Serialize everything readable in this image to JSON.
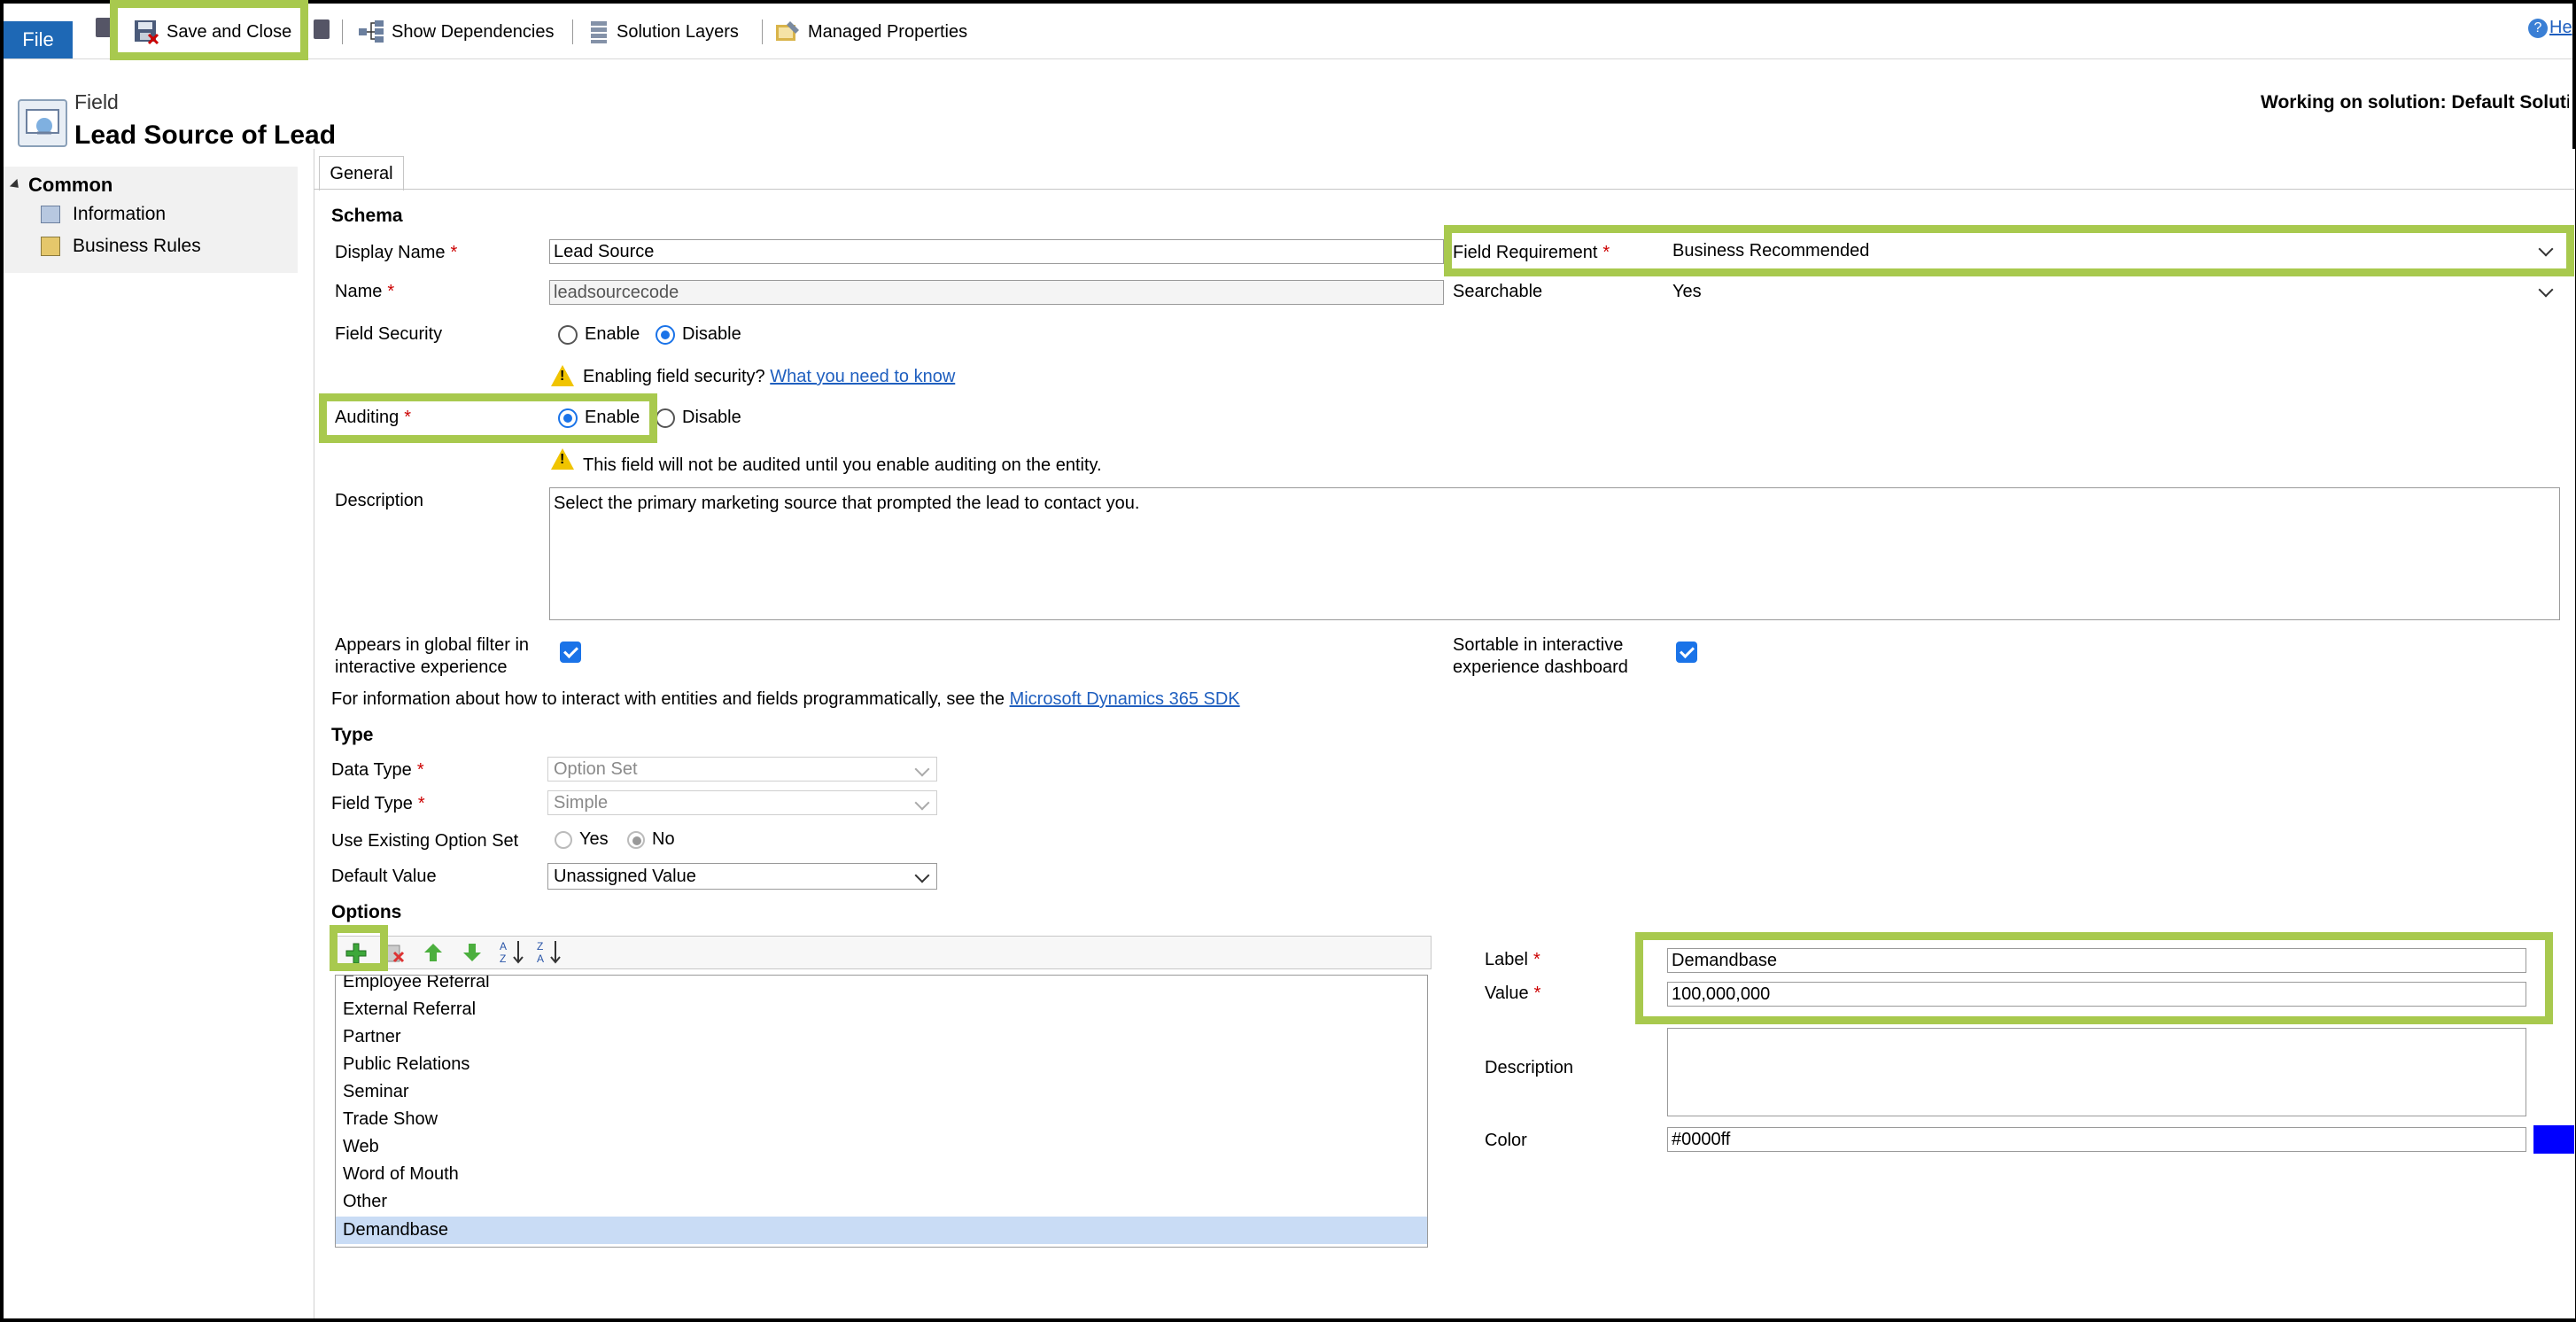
{
  "toolbar": {
    "file": "File",
    "save_close": "Save and Close",
    "show_dependencies": "Show Dependencies",
    "solution_layers": "Solution Layers",
    "managed_properties": "Managed Properties",
    "help": "He"
  },
  "header": {
    "entity_type": "Field",
    "title": "Lead Source of Lead",
    "solution_note": "Working on solution: Default Solutio"
  },
  "nav": {
    "group": "Common",
    "items": [
      "Information",
      "Business Rules"
    ]
  },
  "tabs": [
    "General"
  ],
  "schema": {
    "heading": "Schema",
    "display_name_label": "Display Name",
    "display_name_value": "Lead Source",
    "name_label": "Name",
    "name_value": "leadsourcecode",
    "field_requirement_label": "Field Requirement",
    "field_requirement_value": "Business Recommended",
    "searchable_label": "Searchable",
    "searchable_value": "Yes",
    "field_security_label": "Field Security",
    "enable": "Enable",
    "disable": "Disable",
    "field_security_selected": "Disable",
    "security_warning": "Enabling field security?",
    "security_link": "What you need to know",
    "auditing_label": "Auditing",
    "auditing_selected": "Enable",
    "audit_warning": "This field will not be audited until you enable auditing on the entity.",
    "description_label": "Description",
    "description_value": "Select the primary marketing source that prompted the lead to contact you.",
    "global_filter_label_1": "Appears in global filter in",
    "global_filter_label_2": "interactive experience",
    "global_filter_checked": true,
    "sortable_label_1": "Sortable in interactive",
    "sortable_label_2": "experience dashboard",
    "sortable_checked": true,
    "sdk_note": "For information about how to interact with entities and fields programmatically, see the",
    "sdk_link": "Microsoft Dynamics 365 SDK"
  },
  "type": {
    "heading": "Type",
    "data_type_label": "Data Type",
    "data_type_value": "Option Set",
    "field_type_label": "Field Type",
    "field_type_value": "Simple",
    "existing_label": "Use Existing Option Set",
    "yes": "Yes",
    "no": "No",
    "existing_selected": "No",
    "default_label": "Default Value",
    "default_value": "Unassigned Value"
  },
  "options": {
    "heading": "Options",
    "items": [
      "Employee Referral",
      "External Referral",
      "Partner",
      "Public Relations",
      "Seminar",
      "Trade Show",
      "Web",
      "Word of Mouth",
      "Other",
      "Demandbase"
    ],
    "selected": "Demandbase",
    "detail": {
      "label_label": "Label",
      "label_value": "Demandbase",
      "value_label": "Value",
      "value_value": "100,000,000",
      "description_label": "Description",
      "description_value": "",
      "color_label": "Color",
      "color_value": "#0000ff"
    }
  },
  "colors": {
    "highlight": "#a8c94e",
    "file_button": "#1e68b5",
    "selected_row": "#c9dcf5",
    "accent": "#1a73e8"
  }
}
